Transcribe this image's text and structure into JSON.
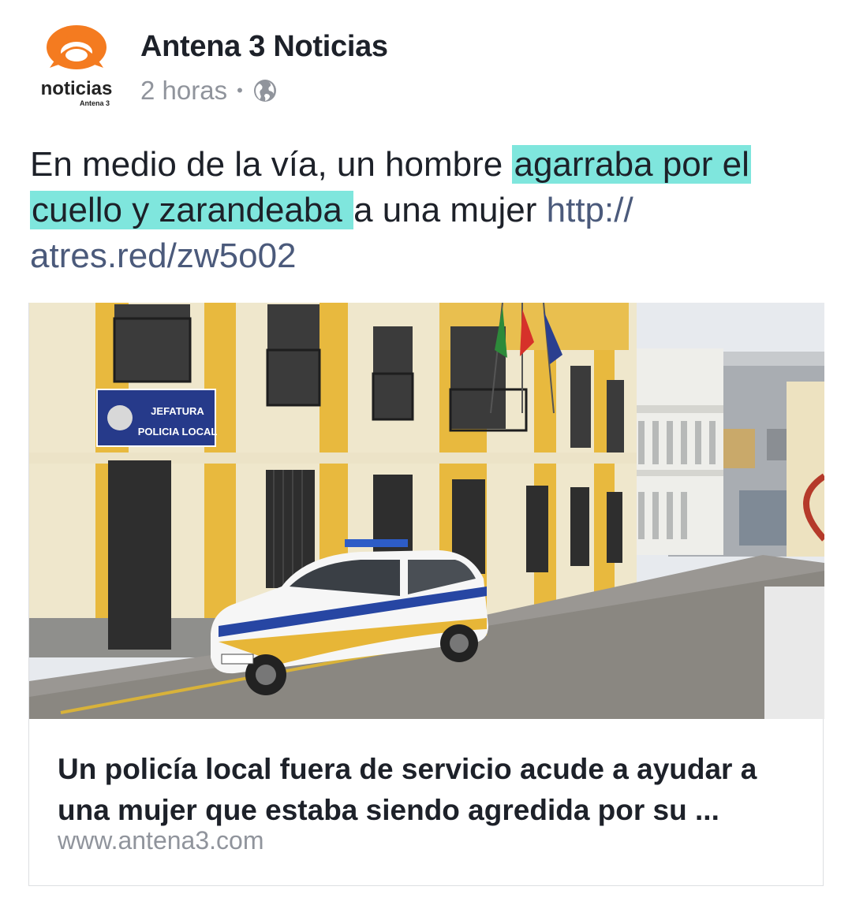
{
  "post": {
    "page_name": "Antena 3 Noticias",
    "timestamp": "2 horas",
    "separator": "•",
    "privacy_icon": "globe-icon",
    "logo": {
      "wordmark": "noticias",
      "sub": "Antena 3",
      "brand_color": "#f47b20"
    },
    "text_before": "En medio de la vía, un hombre ",
    "text_highlight_1": "agarraba por el ",
    "text_highlight_2": "cuello y zarandeaba ",
    "text_after": "a una mujer ",
    "link_text": "http:// atres.red/zw5o02",
    "highlight_color": "#7fe6dd"
  },
  "card": {
    "image_alt": "Jefatura de Policía Local con coche patrulla aparcado",
    "sign_line_1": "JEFATURA",
    "sign_line_2": "POLICIA LOCAL",
    "title": "Un policía local fuera de servicio acude a ayudar a una mujer que estaba siendo agredida por su ...",
    "domain": "www.antena3.com"
  }
}
